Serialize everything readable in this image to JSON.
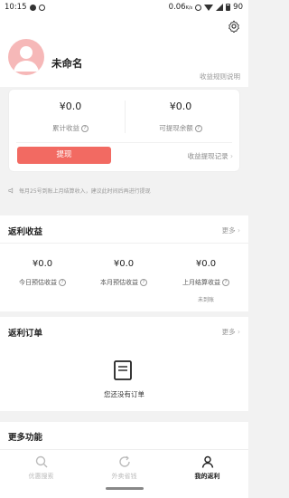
{
  "status_bar": {
    "time": "10:15",
    "speed": "0.06",
    "speed_unit": "K/s",
    "battery": "90"
  },
  "profile": {
    "nickname": "未命名",
    "rule_link": "收益规则说明"
  },
  "earnings": {
    "total": {
      "amount": "¥0.0",
      "label": "累计收益"
    },
    "withdrawable": {
      "amount": "¥0.0",
      "label": "可提现余额"
    },
    "withdraw_button": "提现",
    "withdraw_record_link": "收益提现记录"
  },
  "notice": "每月25号到账上月结算收入，建议此时间后再进行提现",
  "rebate_section": {
    "title": "返利收益",
    "more": "更多",
    "items": [
      {
        "amount": "¥0.0",
        "label": "今日预估收益",
        "sub": ""
      },
      {
        "amount": "¥0.0",
        "label": "本月预估收益",
        "sub": ""
      },
      {
        "amount": "¥0.0",
        "label": "上月结算收益",
        "sub": "未到账"
      }
    ]
  },
  "orders_section": {
    "title": "返利订单",
    "more": "更多",
    "empty_text": "您还没有订单"
  },
  "more_functions": {
    "title": "更多功能"
  },
  "bottom_nav": [
    {
      "label": "优惠搜索",
      "icon": "search-icon",
      "active": false
    },
    {
      "label": "外卖省钱",
      "icon": "refresh-icon",
      "active": false
    },
    {
      "label": "我的返利",
      "icon": "user-icon",
      "active": true
    }
  ],
  "colors": {
    "accent": "#f26a62",
    "avatar": "#f6b8b8",
    "background": "#f2f2f2"
  }
}
